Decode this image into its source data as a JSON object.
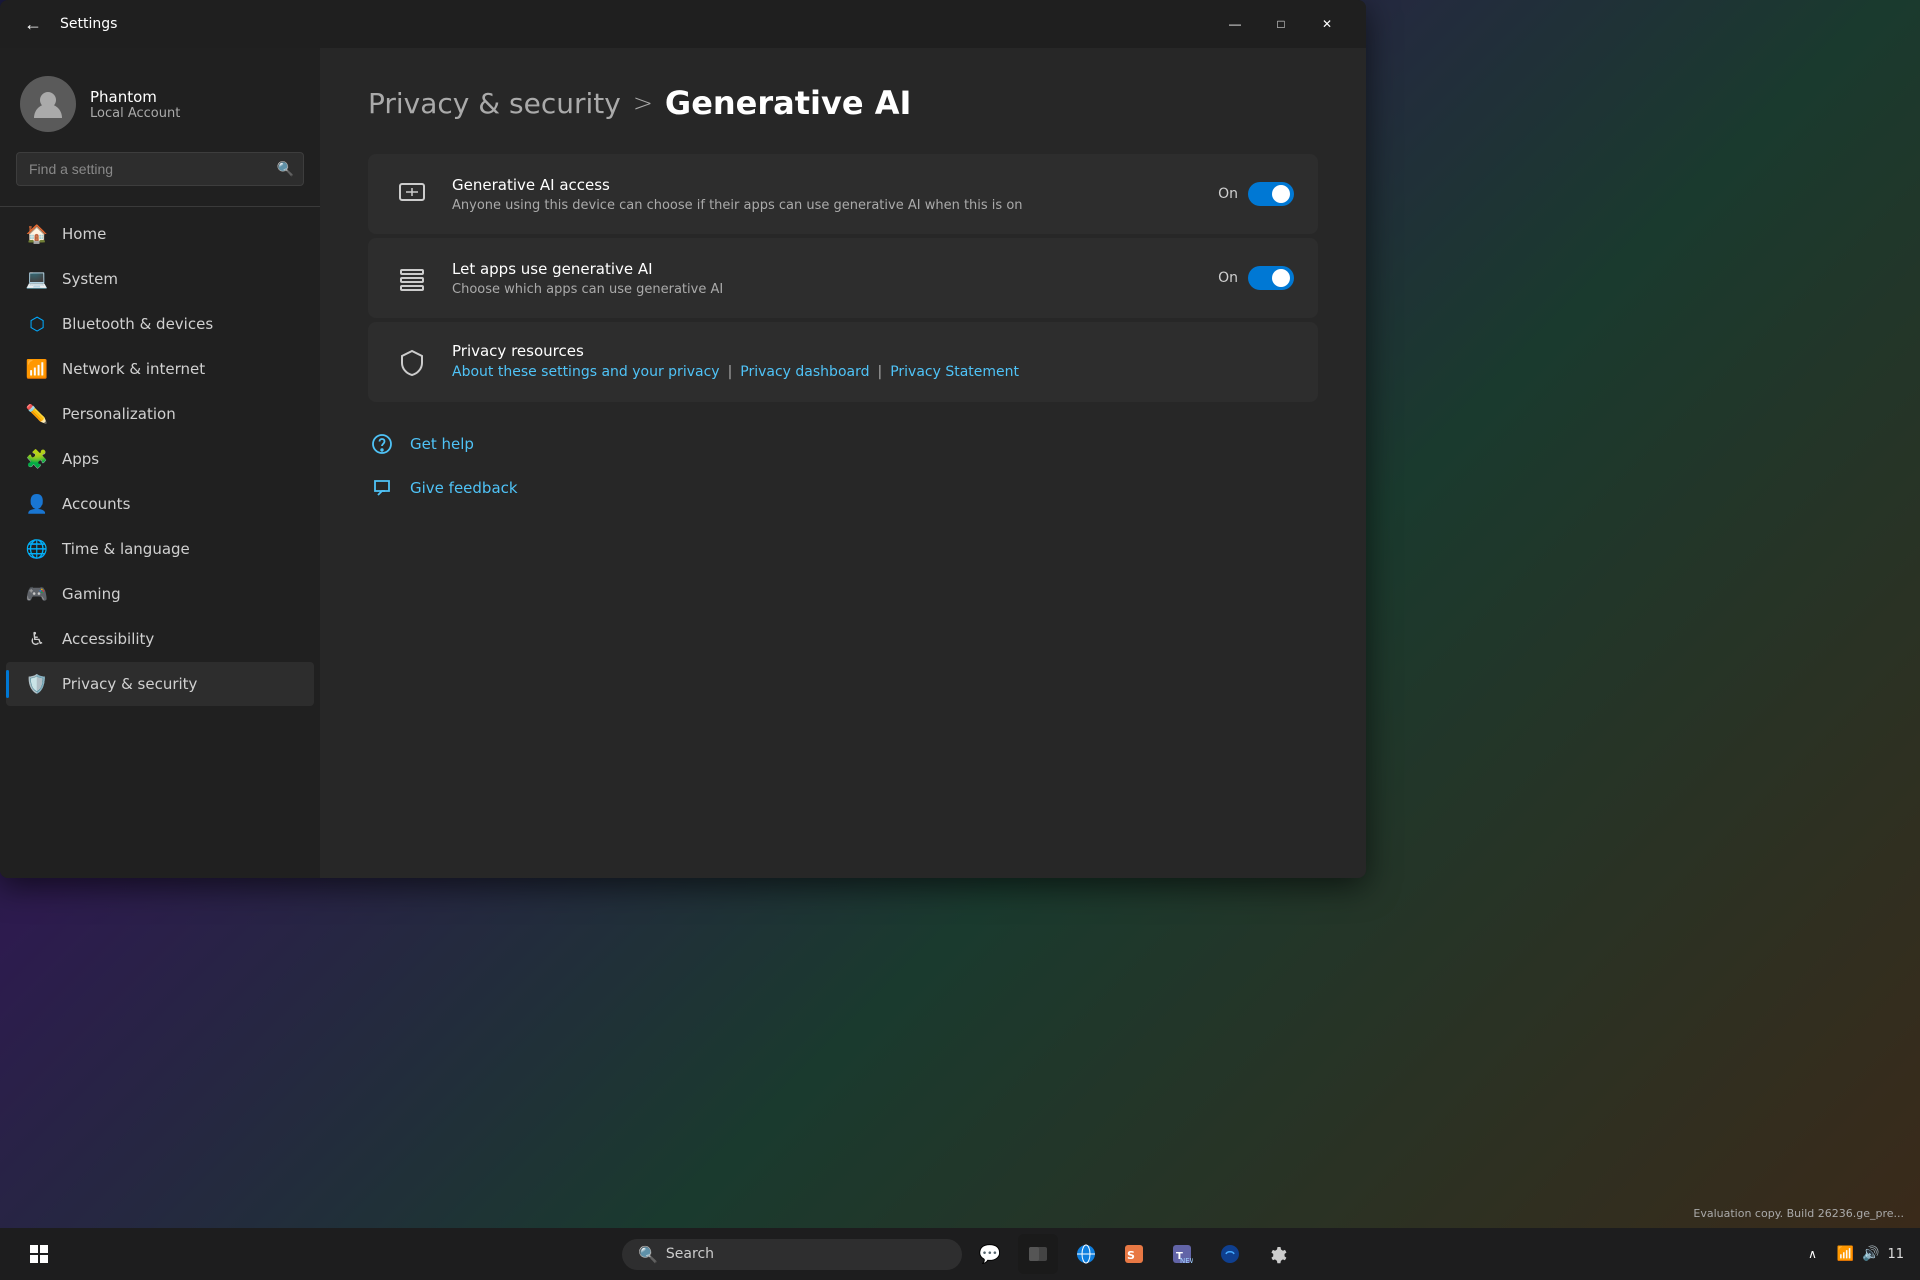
{
  "window": {
    "title": "Settings",
    "back_label": "←"
  },
  "titlebar_controls": {
    "minimize": "—",
    "maximize": "□",
    "close": "✕"
  },
  "user": {
    "name": "Phantom",
    "account_type": "Local Account"
  },
  "search": {
    "placeholder": "Find a setting"
  },
  "nav": {
    "items": [
      {
        "id": "home",
        "label": "Home",
        "icon": "🏠"
      },
      {
        "id": "system",
        "label": "System",
        "icon": "💻"
      },
      {
        "id": "bluetooth",
        "label": "Bluetooth & devices",
        "icon": "🔷"
      },
      {
        "id": "network",
        "label": "Network & internet",
        "icon": "📶"
      },
      {
        "id": "personalization",
        "label": "Personalization",
        "icon": "✏️"
      },
      {
        "id": "apps",
        "label": "Apps",
        "icon": "🧩"
      },
      {
        "id": "accounts",
        "label": "Accounts",
        "icon": "👤"
      },
      {
        "id": "time",
        "label": "Time & language",
        "icon": "🌐"
      },
      {
        "id": "gaming",
        "label": "Gaming",
        "icon": "🎮"
      },
      {
        "id": "accessibility",
        "label": "Accessibility",
        "icon": "♿"
      },
      {
        "id": "privacy",
        "label": "Privacy & security",
        "icon": "🛡️"
      }
    ]
  },
  "breadcrumb": {
    "parent": "Privacy & security",
    "separator": ">",
    "current": "Generative AI"
  },
  "settings": {
    "items": [
      {
        "id": "ai-access",
        "title": "Generative AI access",
        "subtitle": "Anyone using this device can choose if their apps can use generative AI when this is on",
        "toggle_label": "On",
        "toggle_on": true,
        "icon": "🖼️"
      },
      {
        "id": "apps-ai",
        "title": "Let apps use generative AI",
        "subtitle": "Choose which apps can use generative AI",
        "toggle_label": "On",
        "toggle_on": true,
        "icon": "📋"
      }
    ],
    "privacy_resources": {
      "title": "Privacy resources",
      "icon": "🛡️",
      "links": [
        {
          "id": "about-settings",
          "label": "About these settings and your privacy"
        },
        {
          "id": "privacy-dashboard",
          "label": "Privacy dashboard"
        },
        {
          "id": "privacy-statement",
          "label": "Privacy Statement"
        }
      ]
    }
  },
  "help": {
    "get_help_label": "Get help",
    "give_feedback_label": "Give feedback"
  },
  "taskbar": {
    "search_placeholder": "Search",
    "apps": [
      "⊞",
      "🔍",
      "💬",
      "⬛",
      "⬛",
      "📁",
      "🌐",
      "⬛",
      "👥",
      "⬛",
      "⚙️"
    ]
  },
  "eval_notice": "Evaluation copy. Build 26236.ge_pre...",
  "time_display": "11"
}
